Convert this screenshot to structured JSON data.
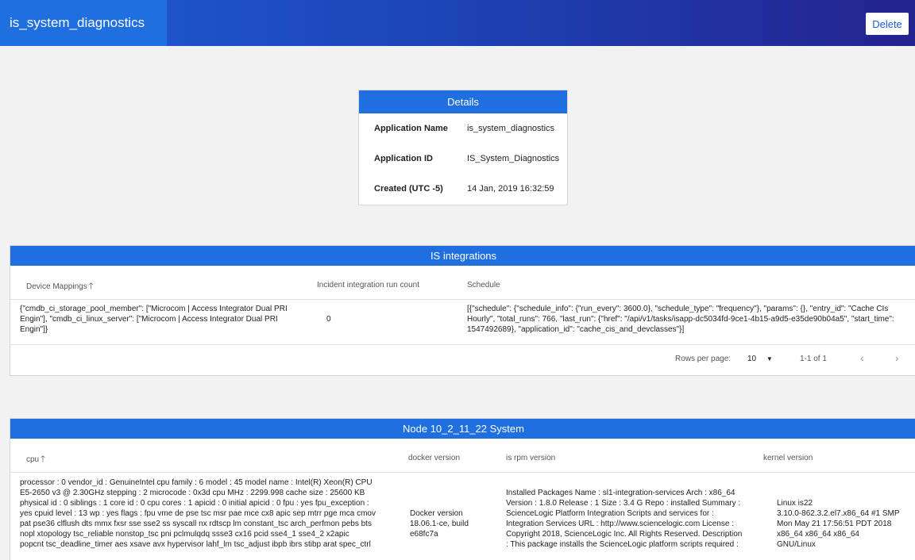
{
  "header": {
    "title": "is_system_diagnostics",
    "delete_label": "Delete"
  },
  "details": {
    "title": "Details",
    "rows": [
      {
        "label": "Application Name",
        "value": "is_system_diagnostics"
      },
      {
        "label": "Application ID",
        "value": "IS_System_Diagnostics"
      },
      {
        "label": "Created (UTC -5)",
        "value": "14 Jan, 2019 16:32:59"
      }
    ]
  },
  "integrations": {
    "title": "IS integrations",
    "columns": [
      "Device Mappings",
      "Incident integration run count",
      "Schedule"
    ],
    "row": {
      "device_mappings": "{\"cmdb_ci_storage_pool_member\": [\"Microcom | Access Integrator Dual PRI Engin\"], \"cmdb_ci_linux_server\": [\"Microcom | Access Integrator Dual PRI Engin\"]}",
      "run_count": "0",
      "schedule": "[{\"schedule\": {\"schedule_info\": {\"run_every\": 3600.0}, \"schedule_type\": \"frequency\"}, \"params\": {}, \"entry_id\": \"Cache CIs Hourly\", \"total_runs\": 766, \"last_run\": {\"href\": \"/api/v1/tasks/isapp-dc5034fd-9ce1-4b15-a9d5-e35de90b04a5\", \"start_time\": 1547492689}, \"application_id\": \"cache_cis_and_devclasses\"}]"
    },
    "pager": {
      "rows_per_page_label": "Rows per page:",
      "rows_per_page_value": "10",
      "range": "1-1 of 1"
    }
  },
  "node": {
    "title": "Node 10_2_11_22 System",
    "columns": [
      "cpu",
      "docker version",
      "is rpm version",
      "kernel version"
    ],
    "row": {
      "cpu_lines": [
        "processor : 0 vendor_id : GenuineIntel cpu family : 6 model : 45 model name : Intel(R) Xeon(R) CPU",
        "E5-2650 v3 @ 2.30GHz stepping : 2 microcode : 0x3d cpu MHz : 2299.998 cache size : 25600 KB",
        "physical id : 0 siblings : 1 core id : 0 cpu cores : 1 apicid : 0 initial apicid : 0 fpu : yes fpu_exception :",
        "yes cpuid level : 13 wp : yes flags : fpu vme de pse tsc msr pae mce cx8 apic sep mtrr pge mca cmov",
        "pat pse36 clflush dts mmx fxsr sse sse2 ss syscall nx rdtscp lm constant_tsc arch_perfmon pebs bts",
        "nopl xtopology tsc_reliable nonstop_tsc pni pclmulqdq ssse3 cx16 pcid sse4_1 sse4_2 x2apic",
        "popcnt tsc_deadline_timer aes xsave avx hypervisor lahf_lm tsc_adjust ibpb ibrs stibp arat spec_ctrl"
      ],
      "docker_lines": [
        "Docker version",
        "18.06.1-ce, build",
        "e68fc7a"
      ],
      "rpm_lines": [
        "Installed Packages Name : sl1-integration-services Arch : x86_64",
        "Version : 1.8.0 Release : 1 Size : 3.4 G Repo : installed Summary :",
        "ScienceLogic Platform Integration Scripts and services for :",
        "Integration Services URL : http://www.sciencelogic.com License :",
        "Copyright 2018, ScienceLogic Inc. All Rights Reserved. Description",
        ": This package installs the ScienceLogic platform scripts required :"
      ],
      "kernel_lines": [
        "Linux is22",
        "3.10.0-862.3.2.el7.x86_64 #1 SMP",
        "Mon May 21 17:56:51 PDT 2018",
        "x86_64 x86_64 x86_64",
        "GNU/Linux"
      ]
    }
  },
  "colors": {
    "header_start": "#1f5bd6",
    "header_end": "#24238f",
    "accent": "#1f6fe0"
  }
}
